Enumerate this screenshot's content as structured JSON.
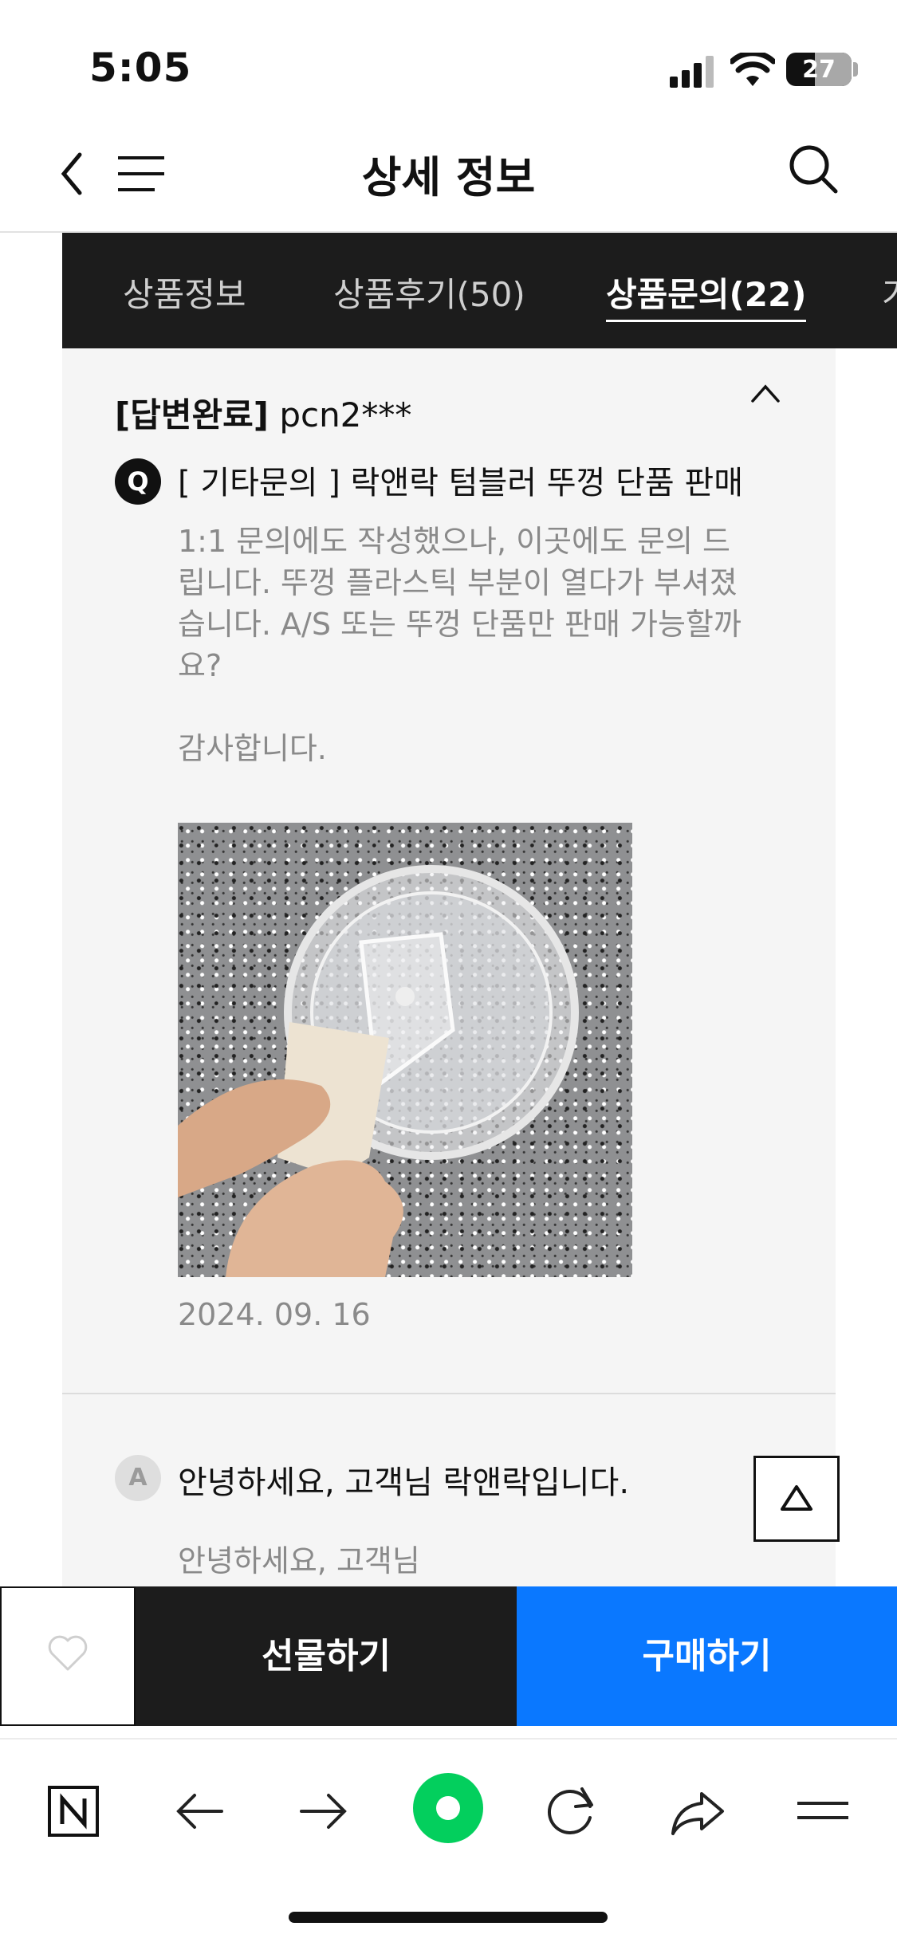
{
  "status_bar": {
    "time": "5:05",
    "battery": "27",
    "battery_level": 0.27
  },
  "header": {
    "title": "상세 정보"
  },
  "tabs": [
    {
      "label": "상품정보"
    },
    {
      "label": "상품후기(50)"
    },
    {
      "label": "상품문의(22)",
      "active": true
    },
    {
      "label": "가"
    }
  ],
  "inquiry": {
    "status": "[답변완료]",
    "user": "pcn2***",
    "q_badge": "Q",
    "title": "[ 기타문의 ] 락앤락 텀블러 뚜껑 단품 판매",
    "body": "1:1 문의에도 작성했으나, 이곳에도 문의 드\n립니다. 뚜껑 플라스틱 부분이 열다가 부셔졌\n습니다. A/S 또는 뚜껑 단품만 판매 가능할까\n요?\n\n감사합니다.",
    "date": "2024. 09. 16"
  },
  "answer": {
    "a_badge": "A",
    "title": "안녕하세요, 고객님 락앤락입니다.",
    "body": "안녕하세요, 고객님"
  },
  "purchase_bar": {
    "gift_label": "선물하기",
    "buy_label": "구매하기"
  },
  "colors": {
    "tab_bg": "#1c1c1c",
    "buy_blue": "#0a78ff",
    "content_bg": "#f5f5f5",
    "browser_green": "#03cf5d"
  },
  "icons": [
    "back-icon",
    "menu-icon",
    "search-icon",
    "chevron-up-icon",
    "scroll-top-icon",
    "heart-icon",
    "naver-n-icon",
    "arrow-left-icon",
    "arrow-right-icon",
    "green-dot-icon",
    "refresh-icon",
    "share-icon",
    "hamburger-icon"
  ]
}
